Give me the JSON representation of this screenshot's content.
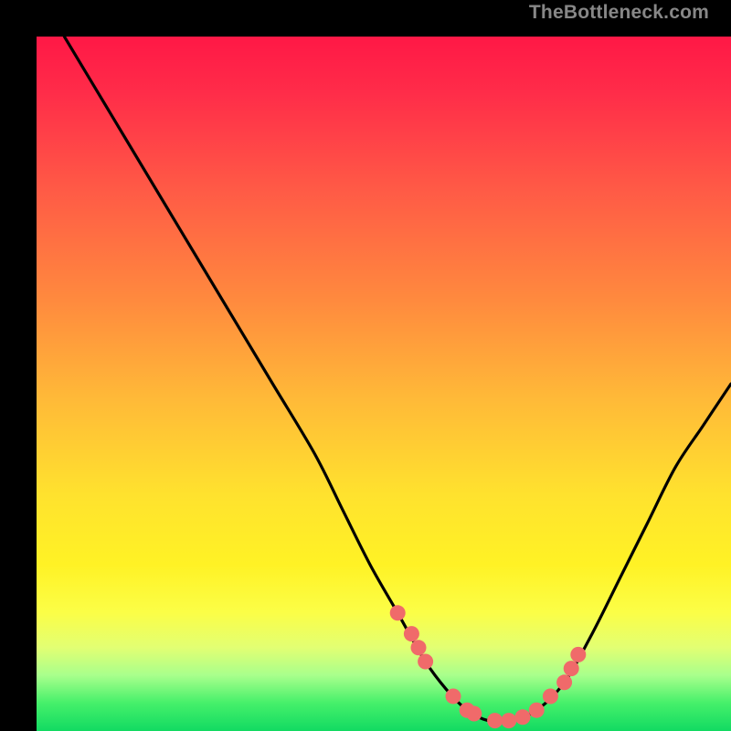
{
  "watermark": "TheBottleneck.com",
  "colors": {
    "page_bg": "#000000",
    "curve": "#000000",
    "marker": "#f06a6a",
    "gradient_top": "#ff1846",
    "gradient_bottom": "#12da62"
  },
  "chart_data": {
    "type": "line",
    "title": "",
    "xlabel": "",
    "ylabel": "",
    "xlim": [
      0,
      100
    ],
    "ylim": [
      0,
      100
    ],
    "grid": false,
    "legend": false,
    "series": [
      {
        "name": "curve",
        "x": [
          4,
          10,
          16,
          22,
          28,
          34,
          40,
          44,
          48,
          52,
          56,
          59,
          62,
          65,
          68,
          72,
          76,
          80,
          84,
          88,
          92,
          96,
          100
        ],
        "y": [
          100,
          90,
          80,
          70,
          60,
          50,
          40,
          32,
          24,
          17,
          10,
          6,
          3,
          1.5,
          1.5,
          3,
          7,
          14,
          22,
          30,
          38,
          44,
          50
        ]
      }
    ],
    "markers": {
      "name": "highlight-points",
      "x": [
        52,
        54,
        55,
        56,
        60,
        62,
        63,
        66,
        68,
        70,
        72,
        74,
        76,
        77,
        78
      ],
      "y": [
        17,
        14,
        12,
        10,
        5,
        3,
        2.5,
        1.5,
        1.5,
        2,
        3,
        5,
        7,
        9,
        11
      ]
    }
  }
}
